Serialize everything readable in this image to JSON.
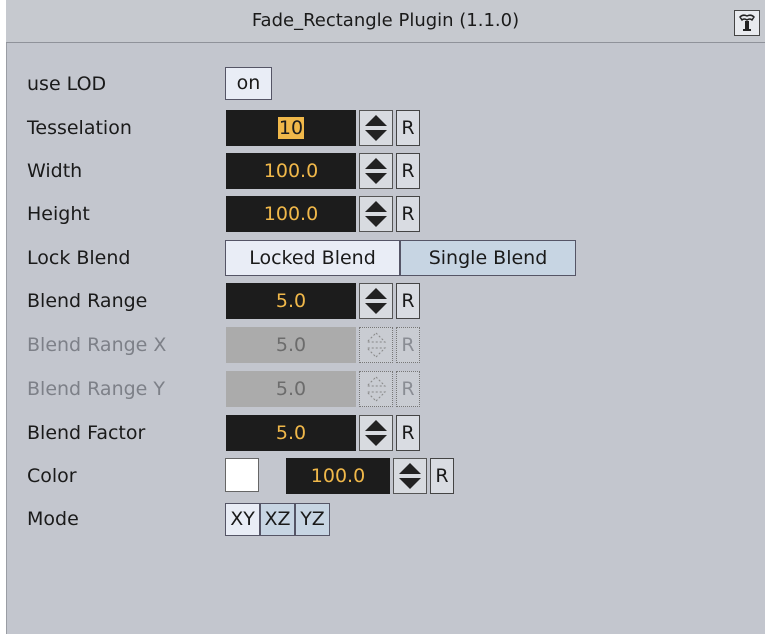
{
  "window": {
    "title": "Fade_Rectangle Plugin (1.1.0)"
  },
  "icons": {
    "info": "info-icon"
  },
  "use_lod": {
    "label": "use LOD",
    "value": "on"
  },
  "tesselation": {
    "label": "Tesselation",
    "value": "10",
    "reset": "R"
  },
  "width": {
    "label": "Width",
    "value": "100.0",
    "reset": "R"
  },
  "height": {
    "label": "Height",
    "value": "100.0",
    "reset": "R"
  },
  "lock_blend": {
    "label": "Lock Blend",
    "options": [
      "Locked Blend",
      "Single Blend"
    ],
    "selected": "Locked Blend"
  },
  "blend_range": {
    "label": "Blend Range",
    "value": "5.0",
    "reset": "R"
  },
  "blend_range_x": {
    "label": "Blend Range X",
    "value": "5.0",
    "reset": "R",
    "disabled": true
  },
  "blend_range_y": {
    "label": "Blend Range Y",
    "value": "5.0",
    "reset": "R",
    "disabled": true
  },
  "blend_factor": {
    "label": "Blend Factor",
    "value": "5.0",
    "reset": "R"
  },
  "color": {
    "label": "Color",
    "swatch": "#ffffff",
    "value": "100.0",
    "reset": "R"
  },
  "mode": {
    "label": "Mode",
    "options": [
      "XY",
      "XZ",
      "YZ"
    ],
    "selected": "XY"
  },
  "colors": {
    "panel_bg": "#c3c6ce",
    "field_bg": "#1c1c1c",
    "field_text": "#f0b84a",
    "toggle_active": "#e9edf6",
    "toggle_inactive": "#c7d5e3"
  }
}
